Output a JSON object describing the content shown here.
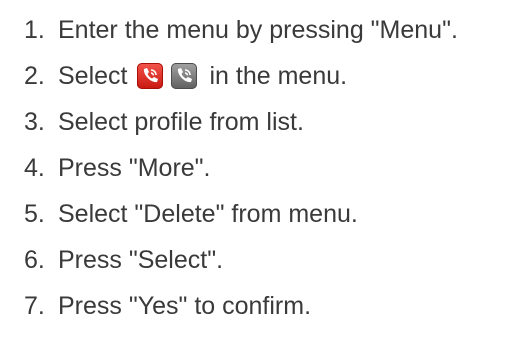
{
  "steps": [
    {
      "number": "1.",
      "text": "Enter the menu by pressing \"Menu\"."
    },
    {
      "number": "2.",
      "text_before": "Select",
      "icons": [
        "red-phone-icon",
        "gray-phone-icon"
      ],
      "text_after": "in the menu."
    },
    {
      "number": "3.",
      "text": "Select profile from list."
    },
    {
      "number": "4.",
      "text": "Press \"More\"."
    },
    {
      "number": "5.",
      "text": "Select \"Delete\" from menu."
    },
    {
      "number": "6.",
      "text": "Press \"Select\"."
    },
    {
      "number": "7.",
      "text": "Press \"Yes\" to confirm."
    }
  ],
  "colors": {
    "text": "#3a3a3a",
    "red_icon": "#e0271f",
    "gray_icon": "#7a7a7a"
  }
}
